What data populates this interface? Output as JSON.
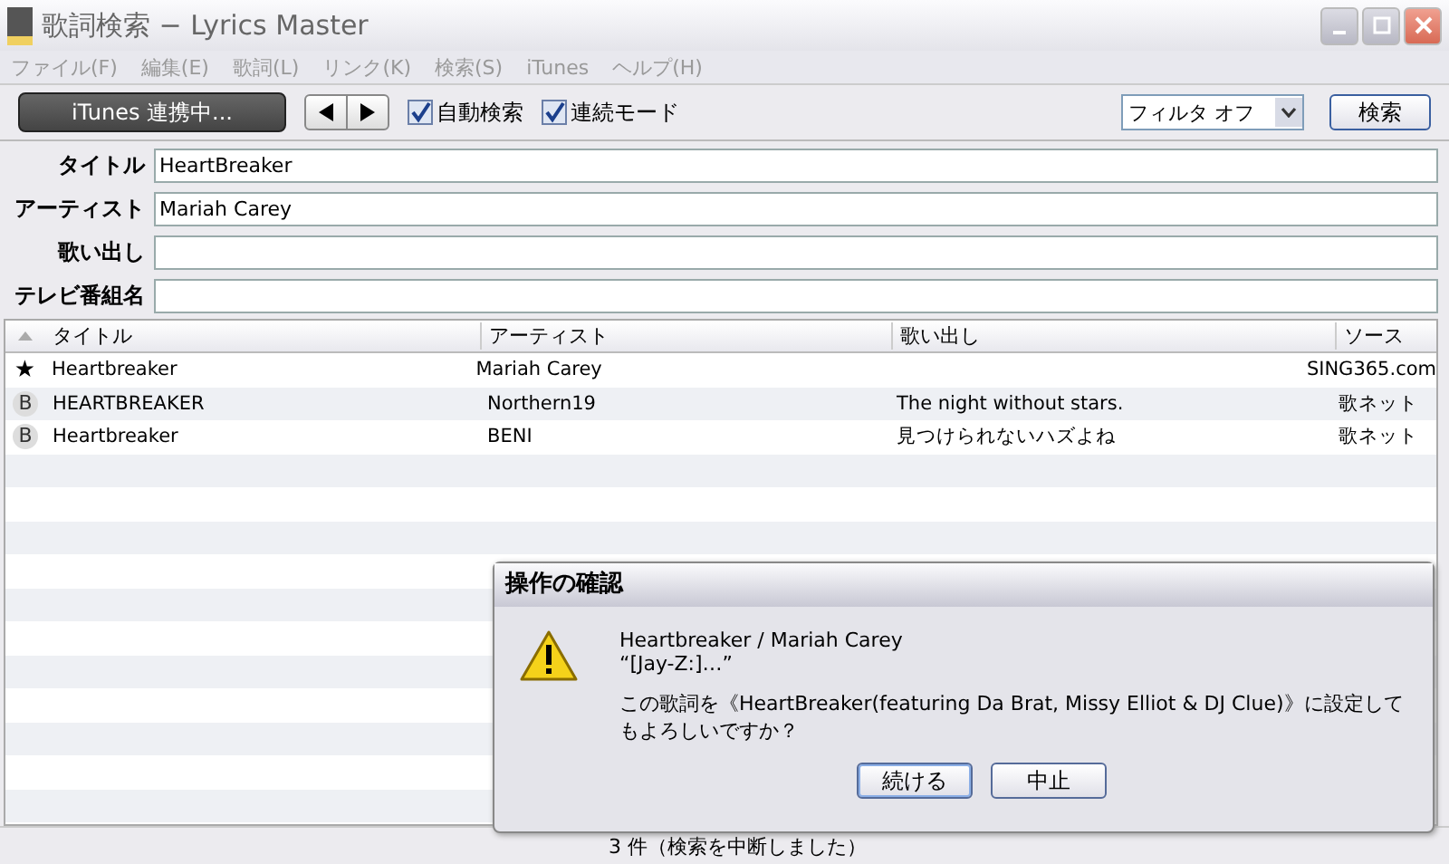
{
  "window": {
    "title": "歌詞検索 − Lyrics Master"
  },
  "menu": [
    {
      "label": "ファイル(F)",
      "disabled": true
    },
    {
      "label": "編集(E)",
      "disabled": true
    },
    {
      "label": "歌詞(L)",
      "disabled": true
    },
    {
      "label": "リンク(K)",
      "disabled": true
    },
    {
      "label": "検索(S)",
      "disabled": true
    },
    {
      "label": "iTunes",
      "disabled": true
    },
    {
      "label": "ヘルプ(H)",
      "disabled": true
    }
  ],
  "toolbar": {
    "itunes_button": "iTunes 連携中...",
    "checkboxes": [
      {
        "label": "自動検索",
        "checked": true
      },
      {
        "label": "連続モード",
        "checked": true
      }
    ],
    "filter": {
      "value": "フィルタ オフ"
    },
    "search_button": "検索"
  },
  "fields": [
    {
      "label": "タイトル",
      "value": "HeartBreaker"
    },
    {
      "label": "アーティスト",
      "value": "Mariah Carey"
    },
    {
      "label": "歌い出し"
    },
    {
      "label": "テレビ番組名"
    }
  ],
  "table": {
    "columns": [
      "タイトル",
      "アーティスト",
      "歌い出し",
      "ソース"
    ],
    "rows": [
      {
        "marker": "★",
        "kind": "star",
        "cells": [
          "Heartbreaker",
          "Mariah Carey",
          "",
          "SING365.com"
        ]
      },
      {
        "marker": "B",
        "kind": "badge",
        "cells": [
          "HEARTBREAKER",
          "Northern19",
          "The night without stars.",
          "歌ネット"
        ]
      },
      {
        "marker": "B",
        "kind": "badge",
        "cells": [
          "Heartbreaker",
          "BENI",
          "見つけられないハズよね",
          "歌ネット"
        ]
      }
    ]
  },
  "status_bar": "3 件（検索を中断しました）",
  "dialog": {
    "title": "操作の確認",
    "lines": [
      "Heartbreaker / Mariah Carey",
      "“[Jay-Z:]…”"
    ],
    "question": "この歌詞を《HeartBreaker(featuring Da Brat, Missy Elliot & DJ Clue)》に設定してもよろしいですか？",
    "buttons": [
      {
        "label": "続ける",
        "selected": true
      },
      {
        "label": "中止",
        "selected": false
      }
    ]
  }
}
